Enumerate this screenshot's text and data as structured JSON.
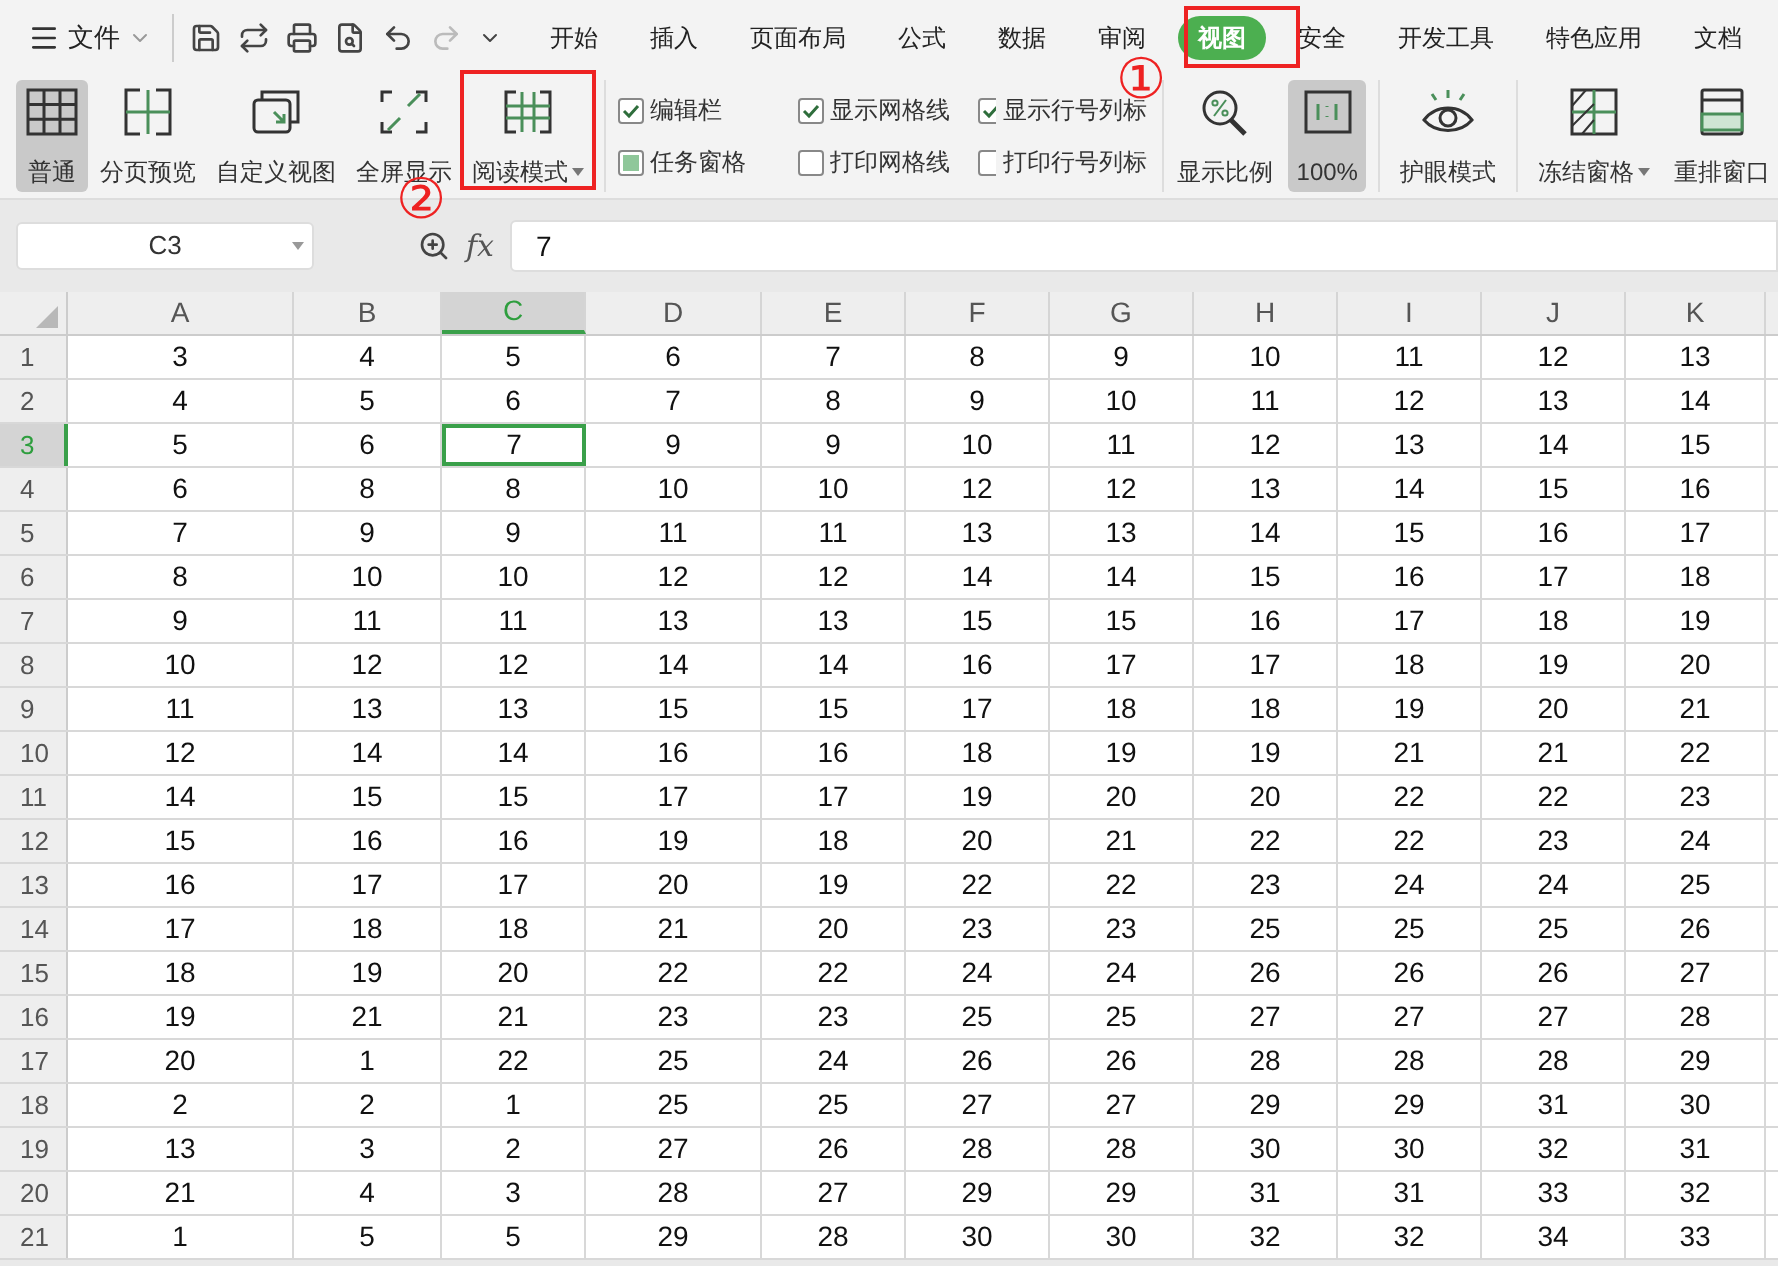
{
  "menu": {
    "file_label": "文件"
  },
  "tabs": [
    {
      "label": "开始",
      "selected": false
    },
    {
      "label": "插入",
      "selected": false
    },
    {
      "label": "页面布局",
      "selected": false
    },
    {
      "label": "公式",
      "selected": false
    },
    {
      "label": "数据",
      "selected": false
    },
    {
      "label": "审阅",
      "selected": false
    },
    {
      "label": "视图",
      "selected": true
    },
    {
      "label": "安全",
      "selected": false
    },
    {
      "label": "开发工具",
      "selected": false
    },
    {
      "label": "特色应用",
      "selected": false
    },
    {
      "label": "文档",
      "selected": false
    }
  ],
  "ribbon_left": [
    {
      "kind": "normal",
      "label": "普通",
      "selected": true,
      "dropdown": false
    },
    {
      "kind": "pagebreak",
      "label": "分页预览",
      "selected": false,
      "dropdown": false
    },
    {
      "kind": "custom",
      "label": "自定义视图",
      "selected": false,
      "dropdown": false
    },
    {
      "kind": "fullscreen",
      "label": "全屏显示",
      "selected": false,
      "dropdown": false
    },
    {
      "kind": "reading",
      "label": "阅读模式",
      "selected": false,
      "dropdown": true
    }
  ],
  "checkboxes": [
    {
      "label": "编辑栏",
      "checked": true,
      "indeterminate": false
    },
    {
      "label": "任务窗格",
      "checked": false,
      "indeterminate": true
    },
    {
      "label": "显示网格线",
      "checked": true,
      "indeterminate": false
    },
    {
      "label": "打印网格线",
      "checked": false,
      "indeterminate": false
    },
    {
      "label": "显示行号列标",
      "checked": true,
      "indeterminate": false
    },
    {
      "label": "打印行号列标",
      "checked": false,
      "indeterminate": false
    }
  ],
  "ribbon_right": [
    {
      "kind": "zoom",
      "label": "显示比例",
      "selected": false,
      "dropdown": false
    },
    {
      "kind": "actual",
      "label": "100%",
      "selected": true,
      "dropdown": false
    },
    {
      "kind": "eye",
      "label": "护眼模式",
      "selected": false,
      "dropdown": false
    },
    {
      "kind": "freeze",
      "label": "冻结窗格",
      "selected": false,
      "dropdown": true
    },
    {
      "kind": "arrange",
      "label": "重排窗口",
      "selected": false,
      "dropdown": false
    }
  ],
  "annotations": [
    {
      "mark": "①"
    },
    {
      "mark": "②"
    }
  ],
  "formula_bar": {
    "cell_ref": "C3",
    "fx": "fx",
    "value": "7"
  },
  "sheet": {
    "columns": [
      {
        "label": "A",
        "selected": false
      },
      {
        "label": "B",
        "selected": false
      },
      {
        "label": "C",
        "selected": true
      },
      {
        "label": "D",
        "selected": false
      },
      {
        "label": "E",
        "selected": false
      },
      {
        "label": "F",
        "selected": false
      },
      {
        "label": "G",
        "selected": false
      },
      {
        "label": "H",
        "selected": false
      },
      {
        "label": "I",
        "selected": false
      },
      {
        "label": "J",
        "selected": false
      },
      {
        "label": "K",
        "selected": false
      }
    ],
    "rows": [
      {
        "label": "1",
        "selected": false,
        "cells": [
          "3",
          "4",
          "5",
          "6",
          "7",
          "8",
          "9",
          "10",
          "11",
          "12",
          "13"
        ]
      },
      {
        "label": "2",
        "selected": false,
        "cells": [
          "4",
          "5",
          "6",
          "7",
          "8",
          "9",
          "10",
          "11",
          "12",
          "13",
          "14"
        ]
      },
      {
        "label": "3",
        "selected": true,
        "cells": [
          "5",
          "6",
          "7",
          "9",
          "9",
          "10",
          "11",
          "12",
          "13",
          "14",
          "15"
        ]
      },
      {
        "label": "4",
        "selected": false,
        "cells": [
          "6",
          "8",
          "8",
          "10",
          "10",
          "12",
          "12",
          "13",
          "14",
          "15",
          "16"
        ]
      },
      {
        "label": "5",
        "selected": false,
        "cells": [
          "7",
          "9",
          "9",
          "11",
          "11",
          "13",
          "13",
          "14",
          "15",
          "16",
          "17"
        ]
      },
      {
        "label": "6",
        "selected": false,
        "cells": [
          "8",
          "10",
          "10",
          "12",
          "12",
          "14",
          "14",
          "15",
          "16",
          "17",
          "18"
        ]
      },
      {
        "label": "7",
        "selected": false,
        "cells": [
          "9",
          "11",
          "11",
          "13",
          "13",
          "15",
          "15",
          "16",
          "17",
          "18",
          "19"
        ]
      },
      {
        "label": "8",
        "selected": false,
        "cells": [
          "10",
          "12",
          "12",
          "14",
          "14",
          "16",
          "17",
          "17",
          "18",
          "19",
          "20"
        ]
      },
      {
        "label": "9",
        "selected": false,
        "cells": [
          "11",
          "13",
          "13",
          "15",
          "15",
          "17",
          "18",
          "18",
          "19",
          "20",
          "21"
        ]
      },
      {
        "label": "10",
        "selected": false,
        "cells": [
          "12",
          "14",
          "14",
          "16",
          "16",
          "18",
          "19",
          "19",
          "21",
          "21",
          "22"
        ]
      },
      {
        "label": "11",
        "selected": false,
        "cells": [
          "14",
          "15",
          "15",
          "17",
          "17",
          "19",
          "20",
          "20",
          "22",
          "22",
          "23"
        ]
      },
      {
        "label": "12",
        "selected": false,
        "cells": [
          "15",
          "16",
          "16",
          "19",
          "18",
          "20",
          "21",
          "22",
          "22",
          "23",
          "24"
        ]
      },
      {
        "label": "13",
        "selected": false,
        "cells": [
          "16",
          "17",
          "17",
          "20",
          "19",
          "22",
          "22",
          "23",
          "24",
          "24",
          "25"
        ]
      },
      {
        "label": "14",
        "selected": false,
        "cells": [
          "17",
          "18",
          "18",
          "21",
          "20",
          "23",
          "23",
          "25",
          "25",
          "25",
          "26"
        ]
      },
      {
        "label": "15",
        "selected": false,
        "cells": [
          "18",
          "19",
          "20",
          "22",
          "22",
          "24",
          "24",
          "26",
          "26",
          "26",
          "27"
        ]
      },
      {
        "label": "16",
        "selected": false,
        "cells": [
          "19",
          "21",
          "21",
          "23",
          "23",
          "25",
          "25",
          "27",
          "27",
          "27",
          "28"
        ]
      },
      {
        "label": "17",
        "selected": false,
        "cells": [
          "20",
          "1",
          "22",
          "25",
          "24",
          "26",
          "26",
          "28",
          "28",
          "28",
          "29"
        ]
      },
      {
        "label": "18",
        "selected": false,
        "cells": [
          "2",
          "2",
          "1",
          "25",
          "25",
          "27",
          "27",
          "29",
          "29",
          "31",
          "30"
        ]
      },
      {
        "label": "19",
        "selected": false,
        "cells": [
          "13",
          "3",
          "2",
          "27",
          "26",
          "28",
          "28",
          "30",
          "30",
          "32",
          "31"
        ]
      },
      {
        "label": "20",
        "selected": false,
        "cells": [
          "21",
          "4",
          "3",
          "28",
          "27",
          "29",
          "29",
          "31",
          "31",
          "33",
          "32"
        ]
      },
      {
        "label": "21",
        "selected": false,
        "cells": [
          "1",
          "5",
          "5",
          "29",
          "28",
          "30",
          "30",
          "32",
          "32",
          "34",
          "33"
        ]
      }
    ]
  }
}
